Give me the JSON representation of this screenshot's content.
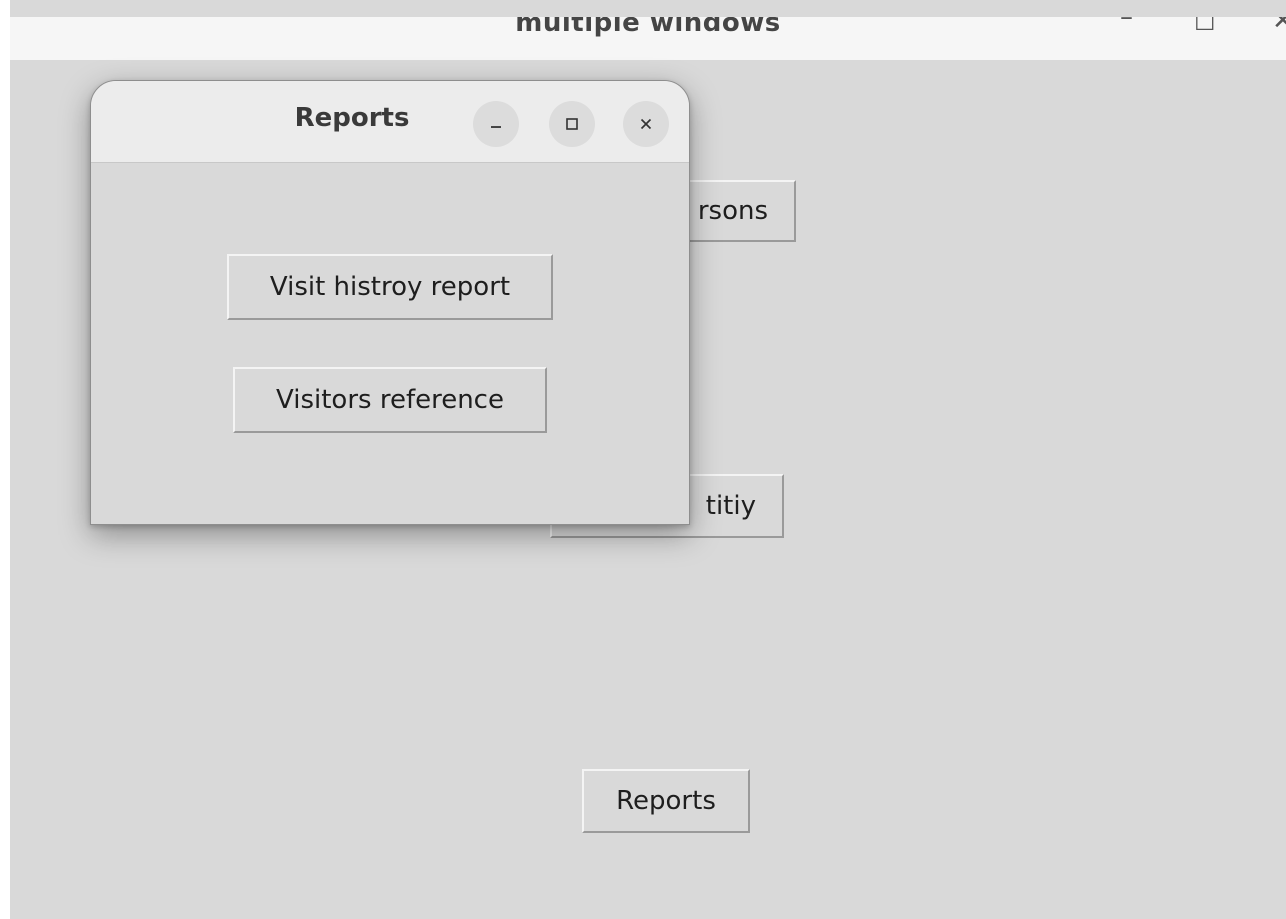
{
  "main_window": {
    "title": "multiple windows",
    "controls": {
      "minimize": "–",
      "maximize": "☐",
      "close": "✕"
    },
    "buttons": {
      "persons_visible": "rsons",
      "identity_visible": "titiy",
      "reports": "Reports"
    }
  },
  "dialog": {
    "title": "Reports",
    "controls": {
      "minimize_icon": "minimize-icon",
      "maximize_icon": "maximize-icon",
      "close_icon": "close-icon"
    },
    "buttons": {
      "visit_history": "Visit histroy report",
      "visitors_reference": "Visitors reference"
    }
  },
  "colors": {
    "window_bg": "#d9d9d9",
    "titlebar_bg": "#f6f6f6",
    "dialog_titlebar_bg": "#ececec",
    "control_circle": "#dcdcdc"
  }
}
